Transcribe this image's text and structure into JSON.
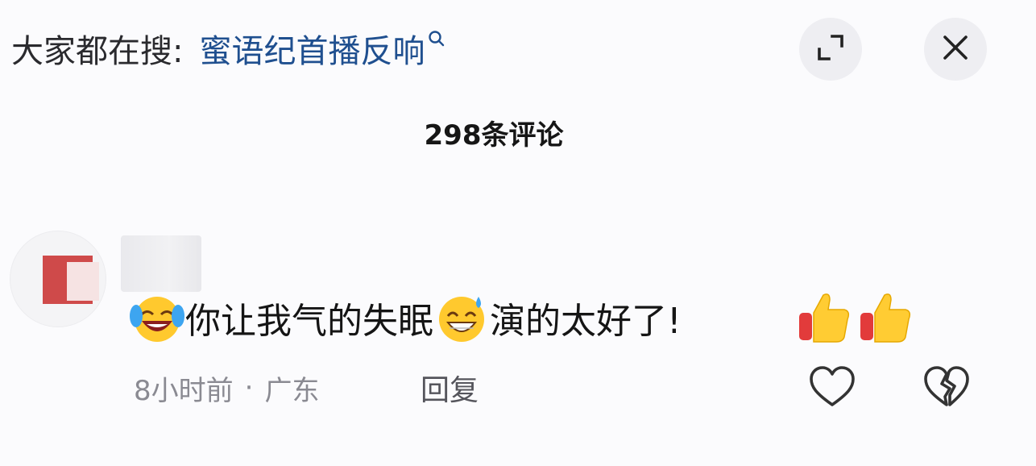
{
  "search": {
    "label": "大家都在搜:",
    "query": "蜜语纪首播反响"
  },
  "header": {
    "expand_icon": "expand-icon",
    "close_icon": "close-icon"
  },
  "comments": {
    "count_label": "298条评论",
    "items": [
      {
        "text_part1": "你让我气的失眠",
        "text_part2": "演的太好了!",
        "emoji_1": "crying-laughing-emoji",
        "emoji_2": "sweat-smile-emoji",
        "trailing_emojis": [
          "thumbs-up-emoji",
          "thumbs-up-emoji"
        ],
        "time": "8小时前",
        "separator": "·",
        "location": "广东",
        "reply_label": "回复"
      }
    ]
  },
  "colors": {
    "query_blue": "#1f4f8f",
    "meta_gray": "#8a8a92"
  }
}
